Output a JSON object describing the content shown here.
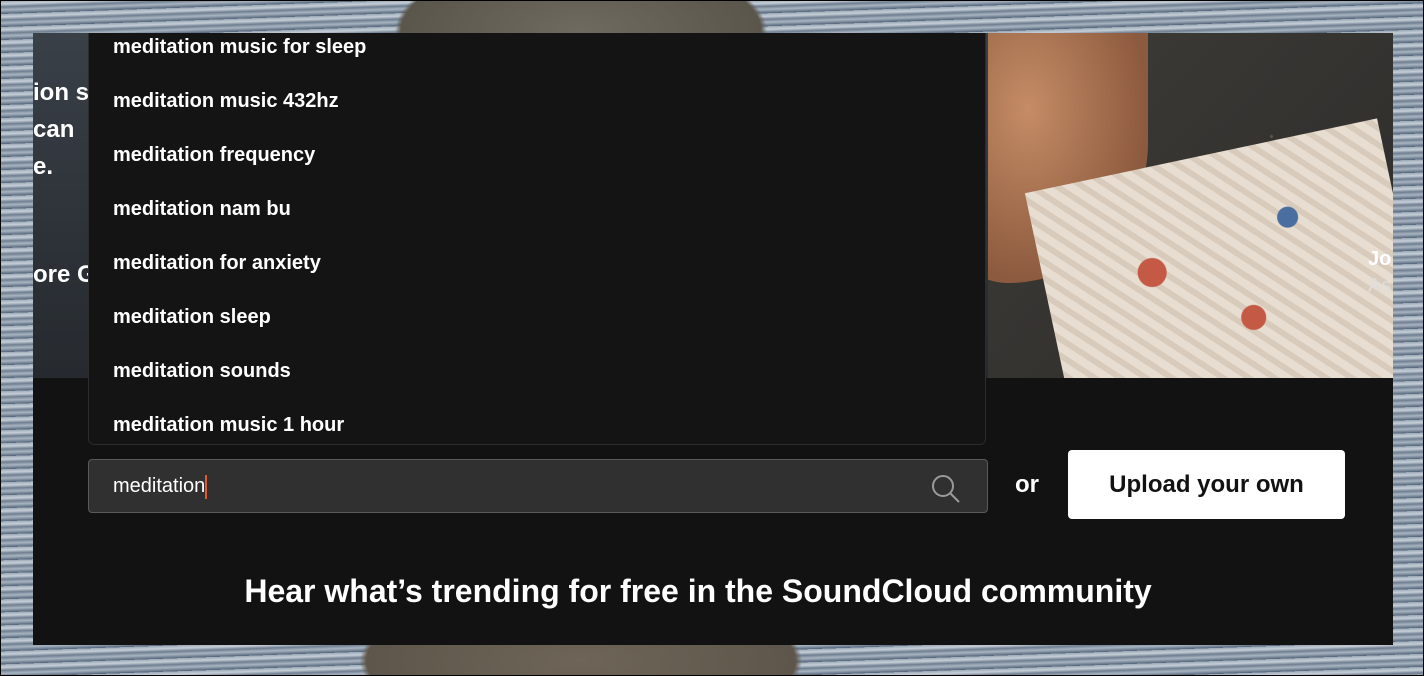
{
  "hero": {
    "left_lines": [
      "ion s",
      " can",
      "e.",
      "ore G"
    ],
    "right_caption_lines": [
      "Jo",
      "As"
    ]
  },
  "search": {
    "value": "meditation",
    "suggestions": [
      "meditation music for sleep",
      "meditation music 432hz",
      "meditation frequency",
      "meditation nam bu",
      "meditation for anxiety",
      "meditation sleep",
      "meditation sounds",
      "meditation music 1 hour"
    ]
  },
  "or_label": "or",
  "upload_button": "Upload your own",
  "trending_heading": "Hear what’s trending for free in the SoundCloud community",
  "colors": {
    "panel_bg": "#121212",
    "input_bg": "#303030",
    "caret": "#e05a2a",
    "button_bg": "#ffffff"
  }
}
